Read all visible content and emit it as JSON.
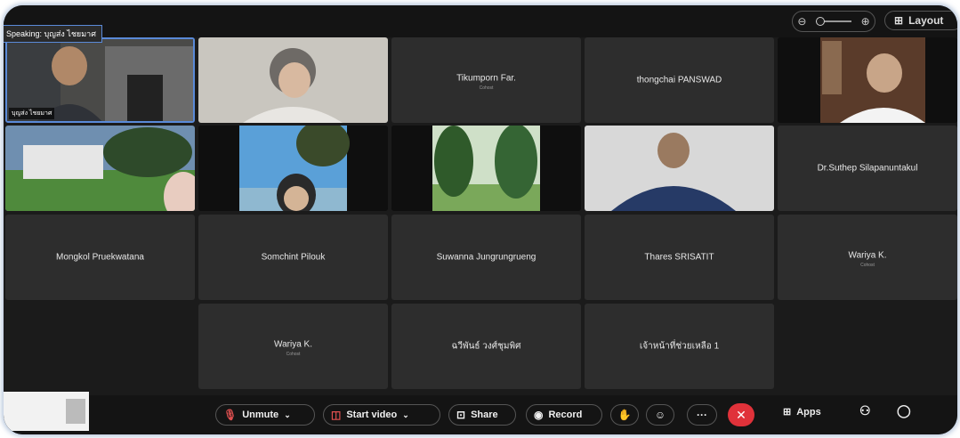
{
  "topbar": {
    "zoom_out_icon": "zoom-out-icon",
    "zoom_in_icon": "zoom-in-icon",
    "layout_label": "Layout"
  },
  "speaking": {
    "label": "Speaking: บุญส่ง ไชยมาศ",
    "name": "บุญส่ง ไชยมาศ"
  },
  "participants": [
    {
      "name": "Tikumporn Far.",
      "role": "Cohost"
    },
    {
      "name": "thongchai PANSWAD",
      "role": ""
    },
    {
      "name": "Dr.Suthep Silapanuntakul",
      "role": ""
    },
    {
      "name": "Mongkol Pruekwatana",
      "role": ""
    },
    {
      "name": "Somchint Pilouk",
      "role": ""
    },
    {
      "name": "Suwanna Jungrungrueng",
      "role": ""
    },
    {
      "name": "Thares SRISATIT",
      "role": ""
    },
    {
      "name": "Wariya K.",
      "role": "Cohost"
    },
    {
      "name": "Wariya K.",
      "role": "Cohost"
    },
    {
      "name": "ฉวีพันธ์ วงศ์ชุมพิศ",
      "role": ""
    },
    {
      "name": "เจ้าหน้าที่ช่วยเหลือ 1",
      "role": ""
    }
  ],
  "toolbar": {
    "unmute": "Unmute",
    "start_video": "Start video",
    "share": "Share",
    "record": "Record",
    "apps": "Apps"
  },
  "colors": {
    "end_call": "#e0323a",
    "active_speaker": "#5a8ad8"
  }
}
